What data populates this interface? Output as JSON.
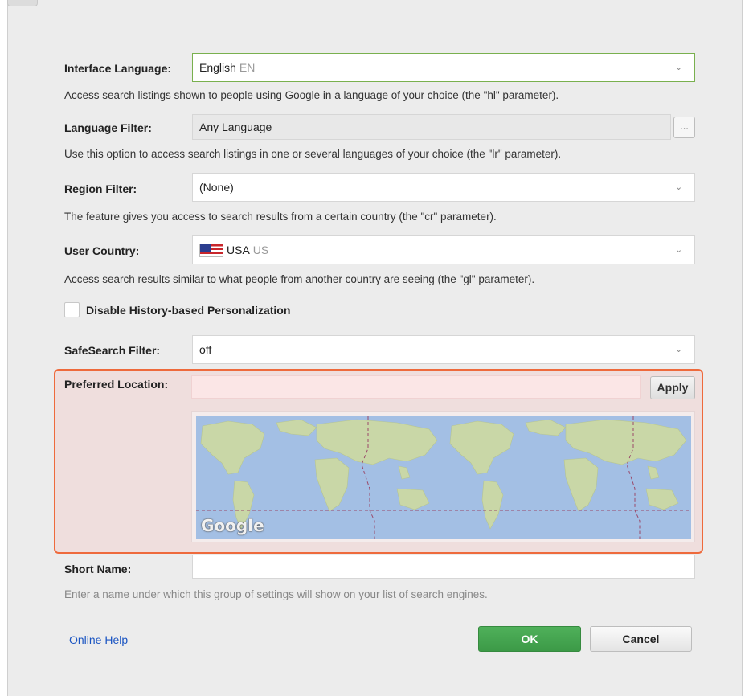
{
  "form": {
    "interface_language": {
      "label": "Interface Language:",
      "value": "English",
      "code": "EN",
      "description": "Access search listings shown to people using Google in a language of your choice (the \"hl\" parameter)."
    },
    "language_filter": {
      "label": "Language Filter:",
      "value": "Any Language",
      "button": "...",
      "description": "Use this option to access search listings in one or several languages of your choice (the \"lr\" parameter)."
    },
    "region_filter": {
      "label": "Region Filter:",
      "value": "(None)",
      "description": "The feature gives you access to search results from a certain country (the \"cr\" parameter)."
    },
    "user_country": {
      "label": "User Country:",
      "value": "USA",
      "code": "US",
      "flag_icon": "us-flag-icon",
      "description": "Access search results similar to what people from another country are seeing (the \"gl\" parameter)."
    },
    "disable_history": {
      "label": "Disable History-based Personalization",
      "checked": false
    },
    "safesearch": {
      "label": "SafeSearch Filter:",
      "value": "off"
    },
    "preferred_location": {
      "label": "Preferred Location:",
      "value": "",
      "apply": "Apply",
      "map_brand": "Google"
    },
    "short_name": {
      "label": "Short Name:",
      "value": "",
      "hint": "Enter a name under which this group of settings will show on your list of search engines."
    }
  },
  "footer": {
    "help": "Online Help",
    "ok": "OK",
    "cancel": "Cancel"
  },
  "colors": {
    "accent_green": "#3c9a47",
    "highlight_border": "#ee6a3c",
    "link": "#1b55c2"
  }
}
